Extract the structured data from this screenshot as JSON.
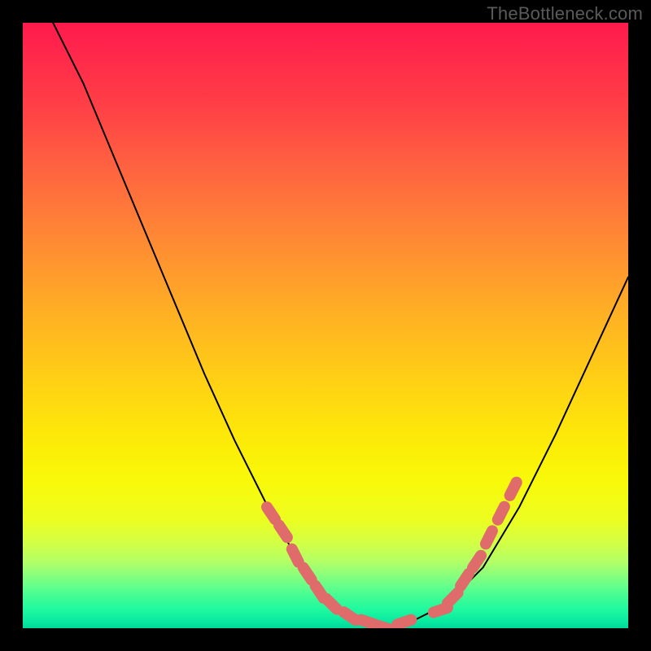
{
  "watermark": "TheBottleneck.com",
  "chart_data": {
    "type": "line",
    "title": "",
    "xlabel": "",
    "ylabel": "",
    "xlim": [
      0,
      100
    ],
    "ylim": [
      0,
      100
    ],
    "note": "Values estimated from pixel positions; x is 0–100 left→right, y is 0–100 where 0 is bottom (plot minimum) and 100 is top.",
    "series": [
      {
        "name": "bottleneck-curve",
        "x": [
          5,
          10,
          15,
          20,
          25,
          30,
          35,
          40,
          45,
          48,
          52,
          56,
          60,
          64,
          70,
          76,
          82,
          88,
          94,
          100
        ],
        "y": [
          100,
          90,
          78,
          66,
          54,
          42,
          31,
          21,
          12,
          7,
          3,
          1,
          0,
          1,
          4,
          10,
          20,
          32,
          45,
          58
        ]
      }
    ],
    "highlight_points": {
      "name": "dots",
      "comment": "Coral dots/capsules along the curve near the trough, estimated positions.",
      "x": [
        41,
        43,
        45,
        47,
        49,
        51,
        54,
        57,
        60,
        63,
        69,
        71,
        73,
        75,
        77,
        79,
        81
      ],
      "y": [
        19,
        16,
        12,
        9,
        6,
        4,
        2,
        1,
        0,
        1,
        3,
        5,
        8,
        11,
        15,
        19,
        23
      ]
    },
    "colors": {
      "curve": "#000000",
      "dots": "#e06b6b",
      "gradient_top": "#ff1a4d",
      "gradient_bottom": "#00d79b",
      "frame": "#000000"
    }
  }
}
